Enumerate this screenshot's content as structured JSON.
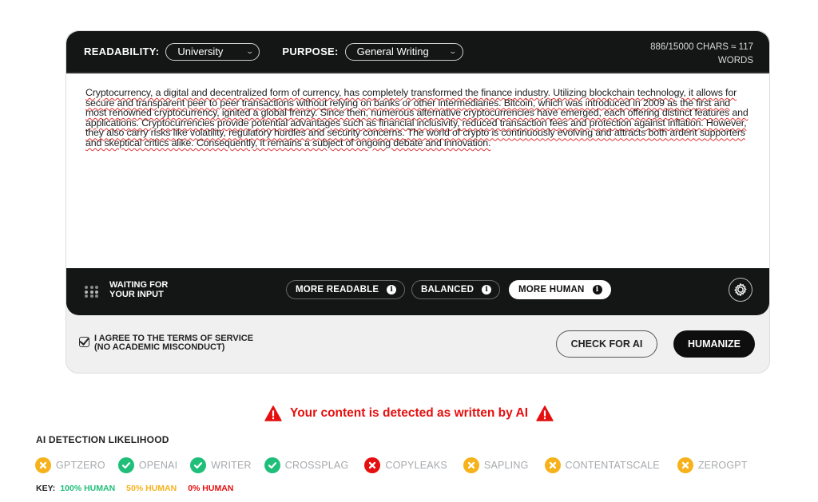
{
  "editor": {
    "readability_label": "READABILITY:",
    "readability_value": "University",
    "purpose_label": "PURPOSE:",
    "purpose_value": "General Writing",
    "counter_line1": "886/15000 CHARS ≈ 117",
    "counter_line2": "WORDS",
    "text": "Cryptocurrency, a digital and decentralized form of currency, has completely transformed the finance industry. Utilizing blockchain technology, it allows for secure and transparent peer to peer transactions without relying on banks or other intermediaries. Bitcoin, which was introduced in 2009 as the first and most renowned cryptocurrency, ignited a global frenzy. Since then, numerous alternative cryptocurrencies have emerged, each offering distinct features and applications. Cryptocurrencies provide potential advantages such as financial inclusivity, reduced transaction fees and protection against inflation. However, they also carry risks like volatility, regulatory hurdles and security concerns. The world of crypto is continuously evolving and attracts both ardent supporters and skeptical critics alike. Consequently, it remains a subject of ongoing debate and innovation.",
    "status_line1": "WAITING FOR",
    "status_line2": "YOUR INPUT",
    "modes": [
      {
        "label": "MORE READABLE",
        "active": false
      },
      {
        "label": "BALANCED",
        "active": false
      },
      {
        "label": "MORE HUMAN",
        "active": true
      }
    ],
    "info_glyph": "i",
    "settings_icon": "gear-icon"
  },
  "actions": {
    "agree_line1": "I AGREE TO THE TERMS OF SERVICE",
    "agree_line2": "(NO ACADEMIC MISCONDUCT)",
    "agree_checked": true,
    "check_label": "CHECK FOR AI",
    "humanize_label": "HUMANIZE"
  },
  "results": {
    "alert": "Your content is detected as written by AI",
    "title": "AI DETECTION LIKELIHOOD",
    "detectors": [
      {
        "name": "GPTZERO",
        "status": "50"
      },
      {
        "name": "OPENAI",
        "status": "100"
      },
      {
        "name": "WRITER",
        "status": "100"
      },
      {
        "name": "CROSSPLAG",
        "status": "100"
      },
      {
        "name": "COPYLEAKS",
        "status": "0"
      },
      {
        "name": "SAPLING",
        "status": "50"
      },
      {
        "name": "CONTENTATSCALE",
        "status": "50"
      },
      {
        "name": "ZEROGPT",
        "status": "50"
      }
    ],
    "key_label": "KEY:",
    "key_items": [
      {
        "label": "100% HUMAN",
        "color": "#1fbf7a"
      },
      {
        "label": "50% HUMAN",
        "color": "#f7b21b"
      },
      {
        "label": "0% HUMAN",
        "color": "#e60f0f"
      }
    ]
  },
  "colors": {
    "human": "#1fbf7a",
    "mixed": "#f7b21b",
    "ai": "#e60f0f",
    "dark": "#141615"
  }
}
